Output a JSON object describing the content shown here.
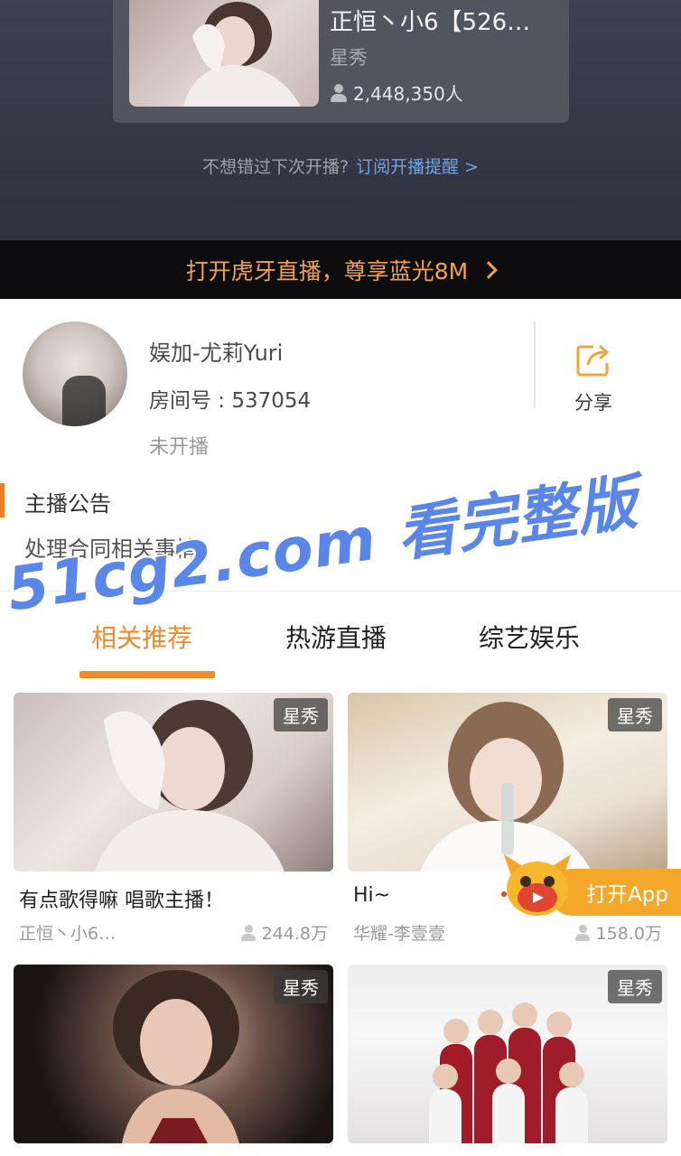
{
  "last_stream": {
    "title": "正恒丶小6【526…",
    "category": "星秀",
    "viewers": "2,448,350人"
  },
  "subscribe": {
    "prompt": "不想错过下次开播?",
    "link": "订阅开播提醒 >"
  },
  "app_banner": {
    "text": "打开虎牙直播，尊享蓝光8M"
  },
  "streamer": {
    "name": "娱加-尤莉Yuri",
    "room": "房间号 : 537054",
    "status": "未开播",
    "share_label": "分享"
  },
  "announcement": {
    "title": "主播公告",
    "text": "处理合同相关事情"
  },
  "watermark": "51cg2.com 看完整版",
  "tabs": [
    {
      "label": "相关推荐",
      "active": true
    },
    {
      "label": "热游直播",
      "active": false
    },
    {
      "label": "综艺娱乐",
      "active": false
    }
  ],
  "cards": [
    {
      "tag": "星秀",
      "title": "有点歌得嘛 唱歌主播！",
      "owner": "正恒丶小6…",
      "count": "244.8万"
    },
    {
      "tag": "星秀",
      "title": "Hi~",
      "owner": "华耀-李壹壹",
      "count": "158.0万"
    },
    {
      "tag": "星秀"
    },
    {
      "tag": "星秀"
    }
  ],
  "float_app": {
    "label": "打开App"
  },
  "colors": {
    "accent": "#f08a2a",
    "banner_text": "#f1a14a",
    "link": "#6ea3e6",
    "watermark": "#5a86e8"
  },
  "icons": [
    "user-icon",
    "chevron-right-icon",
    "share-icon",
    "huya-mascot-icon"
  ]
}
